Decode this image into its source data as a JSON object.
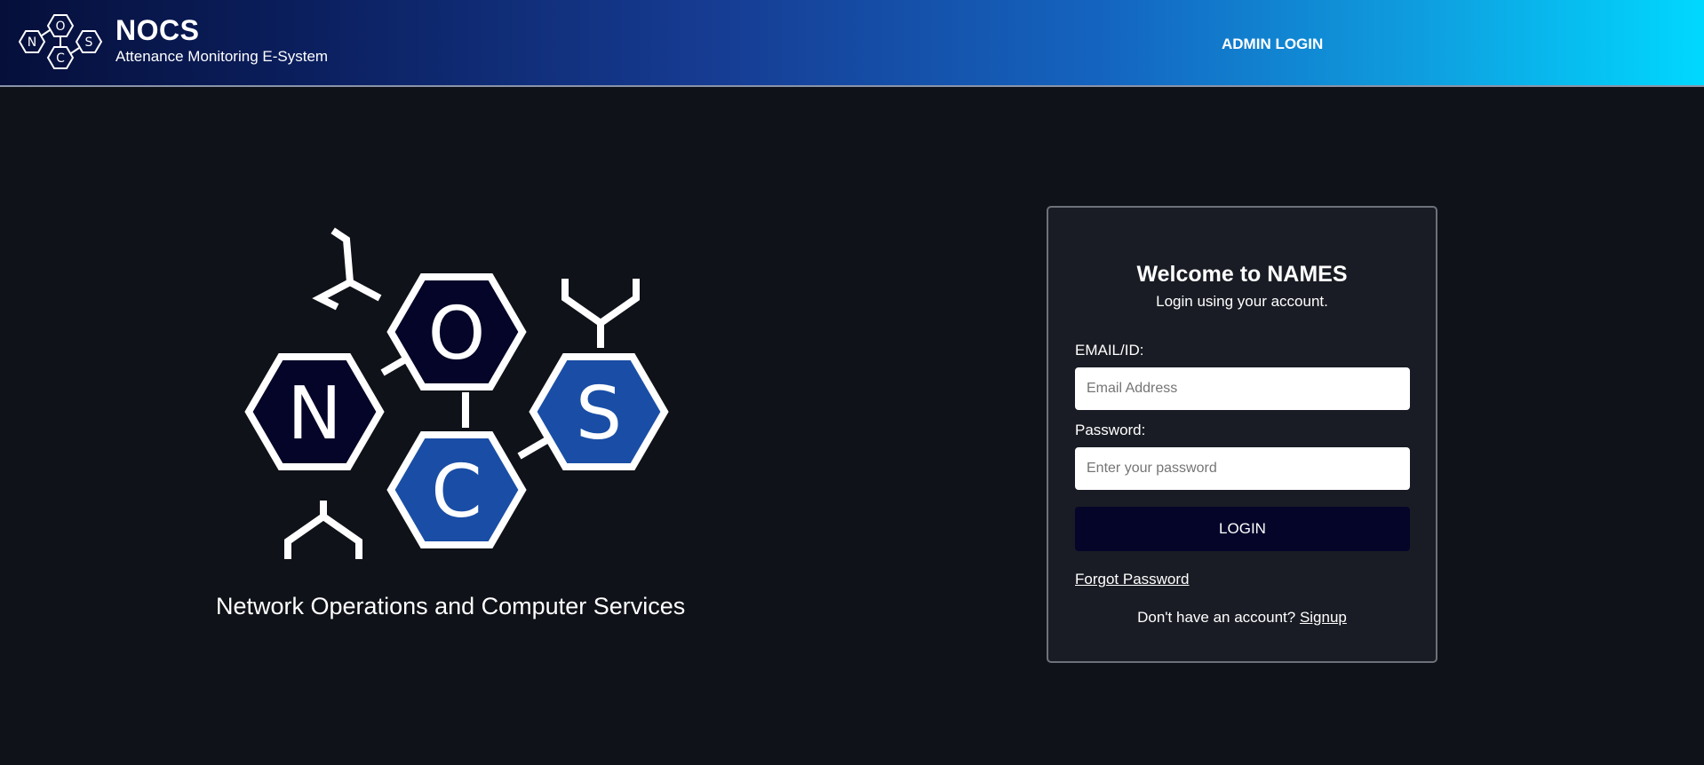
{
  "header": {
    "brand_title": "NOCS",
    "brand_subtitle": "Attenance Monitoring E-System",
    "logo_letters": [
      "N",
      "O",
      "C",
      "S"
    ],
    "admin_login_label": "ADMIN LOGIN"
  },
  "hero": {
    "logo_letters": [
      "N",
      "O",
      "C",
      "S"
    ],
    "caption": "Network Operations and Computer Services"
  },
  "login_card": {
    "title": "Welcome to NAMES",
    "subtitle": "Login using your account.",
    "email_label": "EMAIL/ID:",
    "email_placeholder": "Email Address",
    "email_value": "",
    "password_label": "Password:",
    "password_placeholder": "Enter your password",
    "password_value": "",
    "login_button_label": "LOGIN",
    "forgot_password_label": "Forgot Password",
    "signup_prompt": "Don't have an account?",
    "signup_link_label": "Signup"
  },
  "colors": {
    "background": "#0f1218",
    "card_background": "#191c24",
    "hex_dark": "#05052a",
    "hex_blue": "#1a4ea6",
    "login_button": "#05052a"
  },
  "icons": [
    "nocs-small-logo-icon",
    "nocs-hex-logo-icon"
  ]
}
